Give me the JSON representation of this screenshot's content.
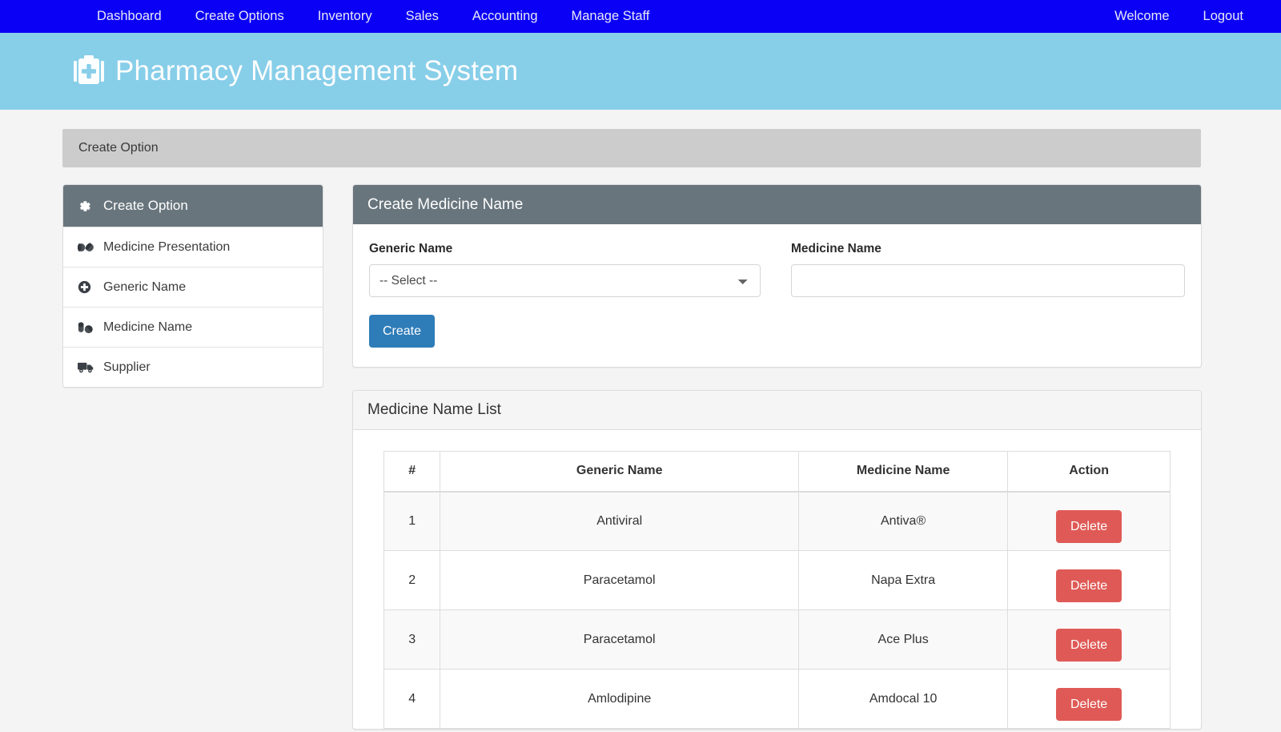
{
  "navbar": {
    "background": "#0a00f5",
    "left_items": [
      {
        "label": "Dashboard",
        "name": "dashboard"
      },
      {
        "label": "Create Options",
        "name": "create-options"
      },
      {
        "label": "Inventory",
        "name": "inventory"
      },
      {
        "label": "Sales",
        "name": "sales"
      },
      {
        "label": "Accounting",
        "name": "accounting"
      },
      {
        "label": "Manage Staff",
        "name": "manage-staff"
      }
    ],
    "right_items": [
      {
        "label": "Welcome",
        "name": "welcome"
      },
      {
        "label": "Logout",
        "name": "logout"
      }
    ]
  },
  "banner": {
    "title": "Pharmacy Management System",
    "icon": "medical-kit-icon",
    "background": "#87cee9"
  },
  "breadcrumb": {
    "label": "Create Option"
  },
  "sidebar": {
    "header": {
      "label": "Create Option",
      "icon": "gear-icon"
    },
    "items": [
      {
        "label": "Medicine Presentation",
        "icon": "capsules-icon"
      },
      {
        "label": "Generic Name",
        "icon": "plus-circle-icon"
      },
      {
        "label": "Medicine Name",
        "icon": "capsule-pill-icon"
      },
      {
        "label": "Supplier",
        "icon": "truck-icon"
      }
    ]
  },
  "create_panel": {
    "title": "Create Medicine Name",
    "generic_name": {
      "label": "Generic Name",
      "selected": "-- Select --",
      "options": [
        "-- Select --"
      ]
    },
    "medicine_name": {
      "label": "Medicine Name",
      "value": "",
      "placeholder": ""
    },
    "submit_label": "Create",
    "submit_color": "#2e7cb8"
  },
  "list_panel": {
    "title": "Medicine Name List",
    "columns": [
      "#",
      "Generic Name",
      "Medicine Name",
      "Action"
    ],
    "action_label": "Delete",
    "action_color": "#df5a56",
    "rows": [
      {
        "num": "1",
        "generic": "Antiviral",
        "medicine": "Antiva®",
        "action": "Delete"
      },
      {
        "num": "2",
        "generic": "Paracetamol",
        "medicine": "Napa Extra",
        "action": "Delete"
      },
      {
        "num": "3",
        "generic": "Paracetamol",
        "medicine": "Ace Plus",
        "action": "Delete"
      },
      {
        "num": "4",
        "generic": "Amlodipine",
        "medicine": "Amdocal 10",
        "action": "Delete"
      }
    ]
  }
}
